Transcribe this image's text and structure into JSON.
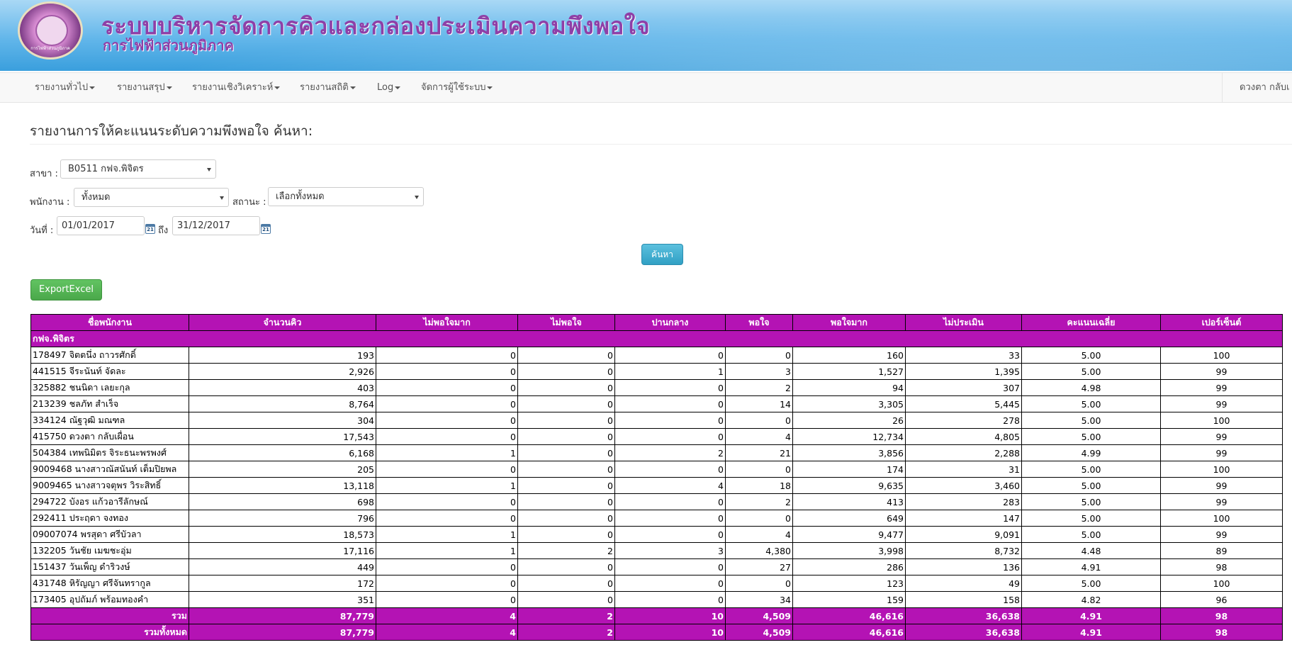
{
  "header": {
    "title": "ระบบบริหารจัดการคิวและกล่องประเมินความพึงพอใจ",
    "subtitle": "การไฟฟ้าส่วนภูมิภาค",
    "logo_text": "การไฟฟ้าส่วนภูมิภาค"
  },
  "nav": {
    "items": [
      {
        "label": "รายงานทั่วไป"
      },
      {
        "label": "รายงานสรุป"
      },
      {
        "label": "รายงานเชิงวิเคราะห์"
      },
      {
        "label": "รายงานสถิติ"
      },
      {
        "label": "Log"
      },
      {
        "label": "จัดการผู้ใช้ระบบ"
      }
    ],
    "user": "ดวงตา กลับเ"
  },
  "page": {
    "title": "รายงานการให้คะแนนระดับความพึงพอใจ ค้นหา:"
  },
  "form": {
    "branch_label": "สาขา :",
    "branch_value": "B0511 กฟจ.พิจิตร",
    "employee_label": "พนักงาน :",
    "employee_value": "ทั้งหมด",
    "status_label": "สถานะ :",
    "status_value": "เลือกทั้งหมด",
    "date_label": "วันที่ :",
    "date_from": "01/01/2017",
    "to_label": "ถึง",
    "date_to": "31/12/2017",
    "calendar_glyph": "21",
    "search_label": "ค้นหา",
    "export_label": "ExportExcel"
  },
  "table": {
    "headers": [
      "ชื่อพนักงาน",
      "จำนวนคิว",
      "ไม่พอใจมาก",
      "ไม่พอใจ",
      "ปานกลาง",
      "พอใจ",
      "พอใจมาก",
      "ไม่ประเมิน",
      "คะแนนเฉลี่ย",
      "เปอร์เซ็นต์"
    ],
    "group": "กฟจ.พิจิตร",
    "rows": [
      [
        "178497 จิตตนึ่ง ถาวรศักดิ์",
        "193",
        "0",
        "0",
        "0",
        "0",
        "160",
        "33",
        "5.00",
        "100"
      ],
      [
        "441515 จีระนันท์ จัดละ",
        "2,926",
        "0",
        "0",
        "1",
        "3",
        "1,527",
        "1,395",
        "5.00",
        "99"
      ],
      [
        "325882 ชนนิดา เลยะกุล",
        "403",
        "0",
        "0",
        "0",
        "2",
        "94",
        "307",
        "4.98",
        "99"
      ],
      [
        "213239 ชลภัท สำเร็จ",
        "8,764",
        "0",
        "0",
        "0",
        "14",
        "3,305",
        "5,445",
        "5.00",
        "99"
      ],
      [
        "334124 ณัฐวุฒิ มณฑล",
        "304",
        "0",
        "0",
        "0",
        "0",
        "26",
        "278",
        "5.00",
        "100"
      ],
      [
        "415750 ดวงตา กลับเผื่อน",
        "17,543",
        "0",
        "0",
        "0",
        "4",
        "12,734",
        "4,805",
        "5.00",
        "99"
      ],
      [
        "504384 เทพนิมิตร จิระธนะพรพงศ์",
        "6,168",
        "1",
        "0",
        "2",
        "21",
        "3,856",
        "2,288",
        "4.99",
        "99"
      ],
      [
        "9009468 นางสาวณัสนันท์ เต็มปิยพล",
        "205",
        "0",
        "0",
        "0",
        "0",
        "174",
        "31",
        "5.00",
        "100"
      ],
      [
        "9009465 นางสาวจตุพร วิระสิทธิ์",
        "13,118",
        "1",
        "0",
        "4",
        "18",
        "9,635",
        "3,460",
        "5.00",
        "99"
      ],
      [
        "294722 บังอร แก้วอารีลักษณ์",
        "698",
        "0",
        "0",
        "0",
        "2",
        "413",
        "283",
        "5.00",
        "99"
      ],
      [
        "292411 ประฤดา จงทอง",
        "796",
        "0",
        "0",
        "0",
        "0",
        "649",
        "147",
        "5.00",
        "100"
      ],
      [
        "09007074 พรสุดา ศรีบัวลา",
        "18,573",
        "1",
        "0",
        "0",
        "4",
        "9,477",
        "9,091",
        "5.00",
        "99"
      ],
      [
        "132205 วันชัย เมฆชะอุ่ม",
        "17,116",
        "1",
        "2",
        "3",
        "4,380",
        "3,998",
        "8,732",
        "4.48",
        "89"
      ],
      [
        "151437 วันเพ็ญ ดำริวงษ์",
        "449",
        "0",
        "0",
        "0",
        "27",
        "286",
        "136",
        "4.91",
        "98"
      ],
      [
        "431748 หิรัญญา ศรีจันทรากูล",
        "172",
        "0",
        "0",
        "0",
        "0",
        "123",
        "49",
        "5.00",
        "100"
      ],
      [
        "173405 อุปถัมภ์ พร้อมทองคำ",
        "351",
        "0",
        "0",
        "0",
        "34",
        "159",
        "158",
        "4.82",
        "96"
      ]
    ],
    "totals": [
      [
        "รวม",
        "87,779",
        "4",
        "2",
        "10",
        "4,509",
        "46,616",
        "36,638",
        "4.91",
        "98"
      ],
      [
        "รวมทั้งหมด",
        "87,779",
        "4",
        "2",
        "10",
        "4,509",
        "46,616",
        "36,638",
        "4.91",
        "98"
      ]
    ]
  }
}
